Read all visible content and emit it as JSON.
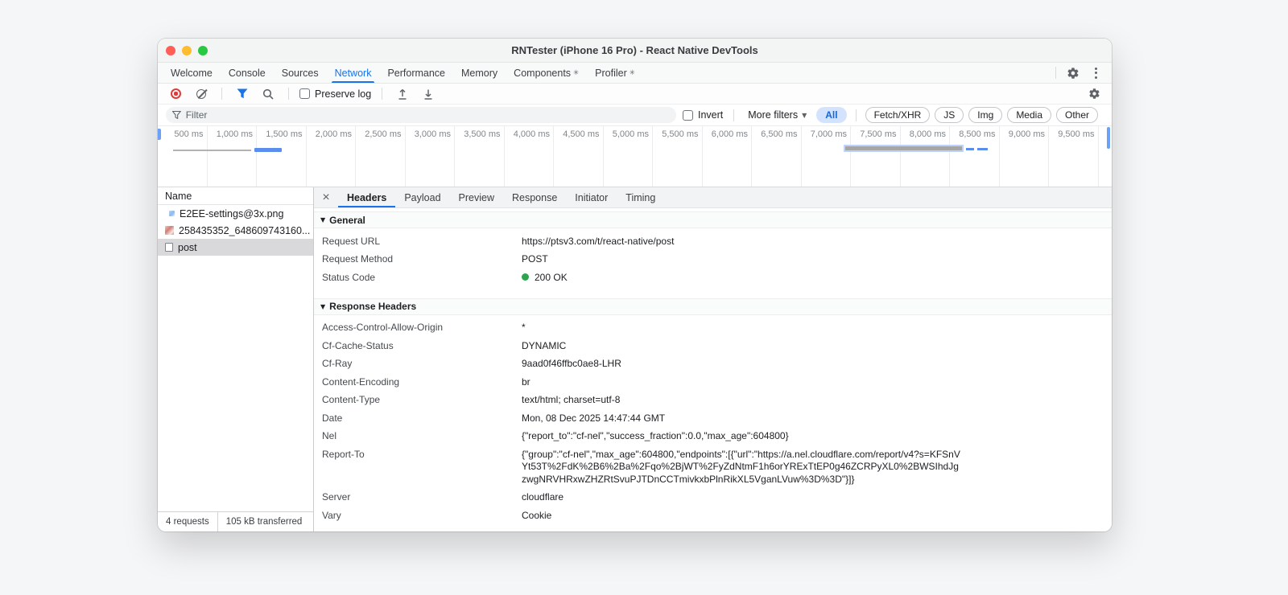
{
  "colors": {
    "accent_blue": "#1a73e8",
    "status_green": "#2da44e",
    "record_red": "#dd3c3c",
    "pill_active_bg": "#d3e3fd",
    "pill_active_text": "#1967d2",
    "selection_gray": "#d9d9dc"
  },
  "window": {
    "title": "RNTester (iPhone 16 Pro) - React Native DevTools"
  },
  "devtools_tabs": {
    "items": [
      {
        "label": "Welcome"
      },
      {
        "label": "Console"
      },
      {
        "label": "Sources"
      },
      {
        "label": "Network",
        "active": true
      },
      {
        "label": "Performance"
      },
      {
        "label": "Memory"
      },
      {
        "label": "Components",
        "badge": "✳"
      },
      {
        "label": "Profiler",
        "badge": "✳"
      }
    ]
  },
  "network_toolbar": {
    "preserve_log_label": "Preserve log"
  },
  "filter_bar": {
    "placeholder": "Filter",
    "invert_label": "Invert",
    "more_filters_label": "More filters",
    "pills": [
      {
        "label": "All",
        "active": true
      },
      {
        "label": "Fetch/XHR"
      },
      {
        "label": "JS"
      },
      {
        "label": "Img"
      },
      {
        "label": "Media"
      },
      {
        "label": "Other"
      }
    ]
  },
  "timeline": {
    "ticks": [
      "500 ms",
      "1,000 ms",
      "1,500 ms",
      "2,000 ms",
      "2,500 ms",
      "3,000 ms",
      "3,500 ms",
      "4,000 ms",
      "4,500 ms",
      "5,000 ms",
      "5,500 ms",
      "6,000 ms",
      "6,500 ms",
      "7,000 ms",
      "7,500 ms",
      "8,000 ms",
      "8,500 ms",
      "9,000 ms",
      "9,500 ms"
    ]
  },
  "request_list": {
    "header": "Name",
    "rows": [
      {
        "name": "E2EE-settings@3x.png",
        "icon": "image-thumbnail"
      },
      {
        "name": "258435352_648609743160...",
        "icon": "image-thumbnail"
      },
      {
        "name": "post",
        "icon": "document",
        "selected": true
      }
    ]
  },
  "status_bar": {
    "requests": "4 requests",
    "transferred": "105 kB transferred"
  },
  "detail_pane": {
    "tabs": [
      {
        "label": "Headers",
        "active": true
      },
      {
        "label": "Payload"
      },
      {
        "label": "Preview"
      },
      {
        "label": "Response"
      },
      {
        "label": "Initiator"
      },
      {
        "label": "Timing"
      }
    ],
    "general": {
      "title": "General",
      "rows": [
        {
          "name": "Request URL",
          "value": "https://ptsv3.com/t/react-native/post"
        },
        {
          "name": "Request Method",
          "value": "POST"
        },
        {
          "name": "Status Code",
          "value": "200 OK",
          "status_color": "#2da44e"
        }
      ]
    },
    "response_headers": {
      "title": "Response Headers",
      "rows": [
        {
          "name": "Access-Control-Allow-Origin",
          "value": "*"
        },
        {
          "name": "Cf-Cache-Status",
          "value": "DYNAMIC"
        },
        {
          "name": "Cf-Ray",
          "value": "9aad0f46ffbc0ae8-LHR"
        },
        {
          "name": "Content-Encoding",
          "value": "br"
        },
        {
          "name": "Content-Type",
          "value": "text/html; charset=utf-8"
        },
        {
          "name": "Date",
          "value": "Mon, 08 Dec 2025 14:47:44 GMT"
        },
        {
          "name": "Nel",
          "value": "{\"report_to\":\"cf-nel\",\"success_fraction\":0.0,\"max_age\":604800}"
        },
        {
          "name": "Report-To",
          "value": "{\"group\":\"cf-nel\",\"max_age\":604800,\"endpoints\":[{\"url\":\"https://a.nel.cloudflare.com/report/v4?s=KFSnVYt53T%2FdK%2B6%2Ba%2Fqo%2BjWT%2FyZdNtmF1h6orYRExTtEP0g46ZCRPyXL0%2BWSIhdJgzwgNRVHRxwZHZRtSvuPJTDnCCTmivkxbPlnRikXL5VganLVuw%3D%3D\"}]}"
        },
        {
          "name": "Server",
          "value": "cloudflare"
        },
        {
          "name": "Vary",
          "value": "Cookie"
        }
      ]
    }
  }
}
